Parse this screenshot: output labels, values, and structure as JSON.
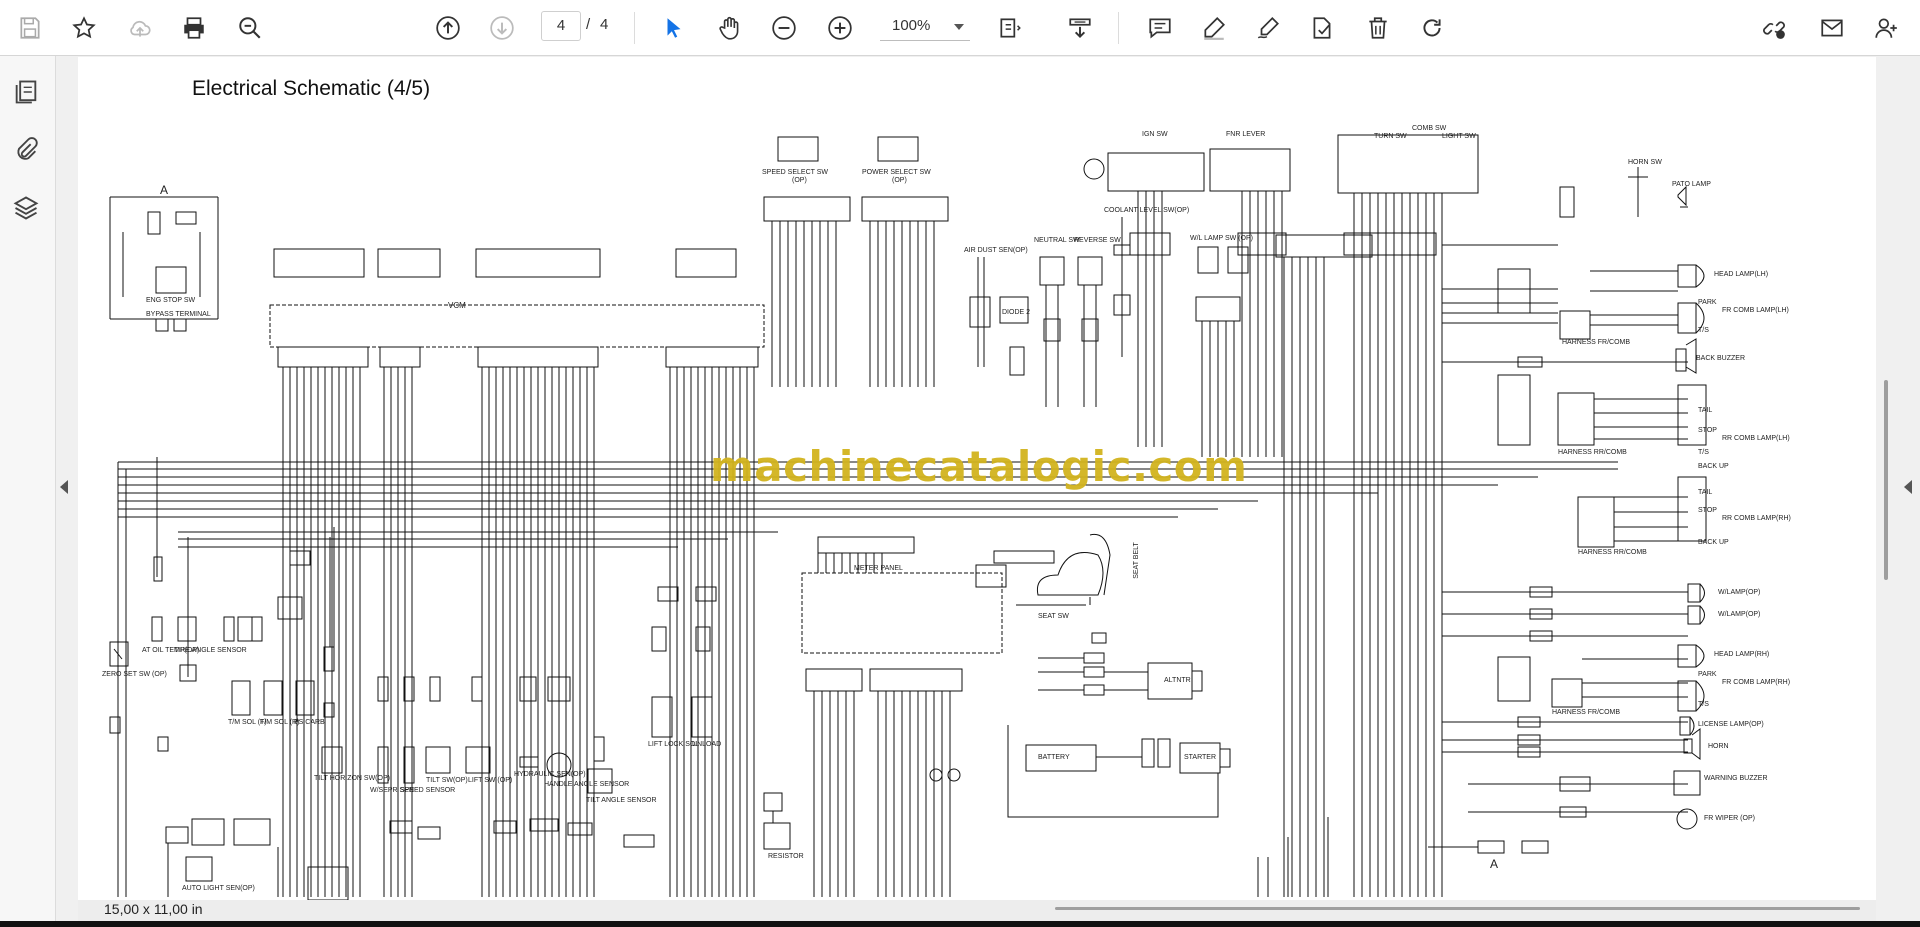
{
  "toolbar": {
    "icons": [
      "save-icon",
      "star-icon",
      "cloud-upload-icon",
      "print-icon",
      "zoom-out-search-icon",
      "page-up-icon",
      "page-down-icon",
      "select-cursor-icon",
      "hand-icon",
      "zoom-minus-icon",
      "zoom-plus-icon",
      "fit-page-icon",
      "scroll-mode-icon",
      "comment-icon",
      "highlight-pen-icon",
      "draw-icon",
      "stamp-icon",
      "delete-icon",
      "redo-icon",
      "share-link-icon",
      "email-icon",
      "add-user-icon"
    ],
    "current_page": "4",
    "page_separator": "/",
    "total_pages": "4",
    "zoom": "100%"
  },
  "left_rail": {
    "icons": [
      "pages-icon",
      "attachments-icon",
      "layers-icon"
    ]
  },
  "document": {
    "title": "Electrical Schematic (4/5)",
    "watermark": "machinecatalogic.com",
    "page_size": "15,00 x 11,00 in",
    "labels": {
      "vcm": "VCM",
      "a_top": "A",
      "a_bottom": "A",
      "eng_stop": "ENG STOP SW",
      "bypass": "BYPASS TERMINAL",
      "speed_select": "SPEED SELECT SW",
      "speed_select_op": "(OP)",
      "power_select": "POWER SELECT SW",
      "power_select_op": "(OP)",
      "ign_sw": "IGN SW",
      "fnr_lever": "FNR LEVER",
      "comb_sw": "COMB SW",
      "turn_sw": "TURN SW",
      "light_sw": "LIGHT SW",
      "horn_sw": "HORN SW",
      "pato_lamp": "PATO LAMP",
      "head_lamp_lh": "HEAD LAMP(LH)",
      "park": "PARK",
      "fr_comb_lh": "FR COMB LAMP(LH)",
      "ts": "T/S",
      "back_buzzer": "BACK BUZZER",
      "tail": "TAIL",
      "stop": "STOP",
      "rr_comb_lh": "RR COMB LAMP(LH)",
      "back_up": "BACK UP",
      "rr_comb_rh": "RR COMB LAMP(RH)",
      "wlamp_op1": "W/LAMP(OP)",
      "wlamp_op2": "W/LAMP(OP)",
      "head_lamp_rh": "HEAD LAMP(RH)",
      "fr_comb_rh": "FR COMB LAMP(RH)",
      "license_lamp": "LICENSE LAMP(OP)",
      "horn": "HORN",
      "warning_buzzer": "WARNING BUZZER",
      "fr_wiper": "FR WIPER (OP)",
      "meter_panel": "METER PANEL",
      "seat_sw": "SEAT SW",
      "seat_belt": "SEAT BELT",
      "altntr": "ALTNTR",
      "battery": "BATTERY",
      "starter": "STARTER",
      "resistor": "RESISTOR",
      "neutral_sw": "NEUTRAL SW",
      "reverse_sw": "REVERSE SW",
      "coolant_level": "COOLANT LEVEL SW(OP)",
      "air_dust": "AIR DUST SEN(OP)",
      "diode": "DIODE 2",
      "wl_lamp_sw": "W/L LAMP SW (OP)",
      "zero_set": "ZERO SET SW (OP)",
      "at_oil": "AT OIL TEMP(OP)",
      "tire_angle": "TIRE ANGLE SENSOR",
      "tm_sol_f": "T/M SOL (F)",
      "tm_sol_r": "T/M SOL (R)",
      "ps_carb": "PS CARB",
      "tilt_horizon": "TILT HORIZON SW(OP)",
      "wsepr": "W/SEPR SEN",
      "speed_sensor": "SPEED SENSOR",
      "tilt_sw": "TILT SW(OP)",
      "lift_sw": "LIFT SW (OP)",
      "hydraulic": "HYDRAULIC SEN(OP)",
      "handle_angle": "HANDLE ANGLE SENSOR",
      "tilt_angle": "TILT ANGLE SENSOR",
      "lift_lock": "LIFT LOCK SOL",
      "unload": "UNLOAD",
      "auto_light": "AUTO LIGHT SEN(OP)",
      "harness_fr": "HARNESS FR/COMB",
      "harness_rr": "HARNESS RR/COMB",
      "harness_rr2": "HARNESS RR/COMB",
      "harness_fr2": "HARNESS FR/COMB"
    }
  }
}
